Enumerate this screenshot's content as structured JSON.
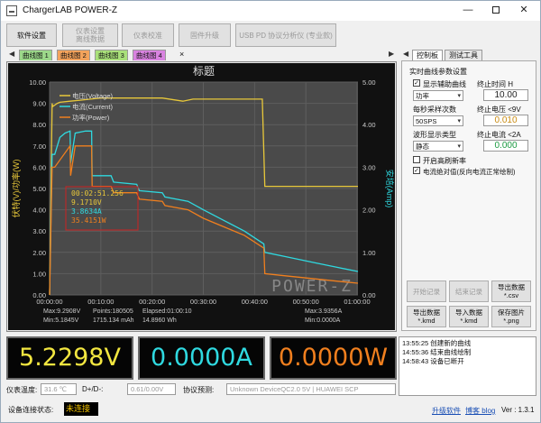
{
  "window": {
    "title": "ChargerLAB POWER-Z",
    "min": "—",
    "max": "☐",
    "close": "✕"
  },
  "toolbar": {
    "settings": "软件设置",
    "dump": "仪表设置\n离线数据",
    "calibrate": "仪表校准",
    "firmware": "固件升级",
    "pd_analyzer": "USB PD 协议分析仪 (专业款)"
  },
  "curve_tabs": [
    {
      "label": "曲线图 1",
      "color": "#9cd88a"
    },
    {
      "label": "曲线图 2",
      "color": "#f3a35c"
    },
    {
      "label": "曲线图 3",
      "color": "#a9e07a"
    },
    {
      "label": "曲线图 4",
      "color": "#d983e0"
    }
  ],
  "tab_close": "×",
  "nav": {
    "left": "◀",
    "right": "▶"
  },
  "chart": {
    "title": "标题",
    "ylabel_left": "伏特(V)/功率(W)",
    "ylabel_right": "安培(Amp)",
    "watermark": "POWER-Z",
    "legend": [
      "电压(Voltage)",
      "电流(Current)",
      "功率(Power)"
    ],
    "readout_box": [
      "00:02:51.256",
      "9.1710V",
      "3.8634A",
      "35.4151W"
    ],
    "footer": {
      "max_v": "Max:9.2908V",
      "min_v": "Min:5.1845V",
      "points": "Points:180505",
      "mah": "1715.134 mAh",
      "elapsed": "Elapsed:01:00:10",
      "wh": "14.8960 Wh",
      "max_a": "Max:3.9356A",
      "min_a": "Min:0.0000A"
    }
  },
  "chart_data": {
    "type": "line",
    "title": "标题",
    "xlabel": "",
    "ylabel": "伏特(V)/功率(W)",
    "ylabel_right": "安培(Amp)",
    "x_ticks": [
      "00:00:00",
      "00:10:00",
      "00:20:00",
      "00:30:00",
      "00:40:00",
      "00:50:00",
      "01:00:00"
    ],
    "y_ticks_left": [
      "0.00",
      "1.00",
      "2.00",
      "3.00",
      "4.00",
      "5.00",
      "6.00",
      "7.00",
      "8.00",
      "9.00",
      "10.00"
    ],
    "y_ticks_right": [
      "0.00",
      "1.00",
      "2.00",
      "3.00",
      "4.00",
      "5.00"
    ],
    "xlim_min": [
      0,
      60.17
    ],
    "ylim_left": [
      0,
      10
    ],
    "ylim_right": [
      0,
      5
    ],
    "grid": true,
    "series": [
      {
        "name": "电压(Voltage)",
        "axis": "left",
        "color": "#e8c83a",
        "x": [
          0,
          0.5,
          0.6,
          1.5,
          2,
          4,
          6,
          8,
          10,
          14,
          18,
          22,
          26,
          28,
          32,
          36,
          40,
          41.5,
          42,
          42.5,
          44,
          48,
          52,
          56,
          60.17
        ],
        "y": [
          0,
          9.0,
          8.85,
          9.0,
          9.05,
          9.1,
          9.15,
          9.2,
          9.25,
          9.25,
          9.25,
          9.25,
          9.1,
          9.2,
          9.2,
          9.2,
          9.2,
          9.2,
          5.1,
          5.1,
          5.1,
          5.1,
          5.1,
          5.1,
          5.1
        ]
      },
      {
        "name": "电流(Current)",
        "axis": "right",
        "color": "#2fd9e0",
        "x": [
          0,
          0.5,
          1,
          2,
          3,
          4,
          4.1,
          5,
          7,
          8.2,
          8.3,
          12,
          12.5,
          17,
          17.5,
          22,
          22.5,
          27,
          30,
          34,
          38,
          41.8,
          42,
          46,
          52,
          56,
          60.17
        ],
        "y": [
          0,
          3.3,
          3.3,
          3.7,
          3.8,
          3.85,
          3.1,
          3.8,
          3.85,
          3.85,
          2.8,
          2.8,
          2.65,
          2.6,
          2.45,
          2.4,
          2.3,
          2.2,
          2.0,
          1.75,
          1.5,
          1.2,
          1.0,
          0.9,
          0.75,
          0.65,
          0.55
        ]
      },
      {
        "name": "功率(Power)",
        "axis": "left",
        "color": "#f07f1e",
        "x": [
          0,
          0.5,
          1,
          4,
          4.1,
          5,
          8.2,
          8.3,
          12,
          12.5,
          17,
          17.5,
          22,
          22.5,
          27,
          30,
          34,
          38,
          41.8,
          42,
          46,
          52,
          56,
          60.17
        ],
        "y": [
          0,
          6.0,
          6.0,
          7.0,
          5.6,
          7.0,
          7.0,
          5.1,
          5.1,
          4.8,
          4.8,
          4.5,
          4.4,
          4.2,
          4.0,
          3.6,
          3.2,
          2.8,
          2.2,
          1.0,
          0.9,
          0.75,
          0.65,
          0.55
        ]
      }
    ]
  },
  "panel": {
    "tabs": [
      "控制板",
      "测试工具"
    ],
    "section": "实时曲线参数设置",
    "show_aux": "显示辅助曲线",
    "aux_value": "功率",
    "end_time_label": "终止时间 H",
    "end_time": "10.00",
    "sample_label": "每秒采样次数",
    "sample_value": "50SPS",
    "end_v_label": "终止电压 <9V",
    "end_v": "0.010",
    "wave_label": "波形显示类型",
    "wave_value": "静态",
    "end_a_label": "终止电流 <2A",
    "end_a": "0.000",
    "hires": "开启高刷新率",
    "absval": "电流绝对值(反向电流正常绘制)",
    "buttons": {
      "start": "开始记录",
      "stop": "结束记录",
      "export_csv": "导出数据\n*.csv",
      "export_kmd": "导出数据\n*.kmd",
      "import_kmd": "导入数据\n*.kmd",
      "save_png": "保存图片\n*.png"
    }
  },
  "readouts": {
    "voltage": "5.2298V",
    "voltage_color": "#f2e640",
    "current": "0.0000A",
    "current_color": "#2fd9e0",
    "power": "0.0000W",
    "power_color": "#f07f1e"
  },
  "status": {
    "temp_label": "仪表温度:",
    "temp": "31.6 ℃",
    "dpdm_label": "D+/D-:",
    "dpdm": "0.61/0.00V",
    "proto_label": "协议预测:",
    "proto": "Unknown DeviceQC2.0 5V | HUAWEI SCP"
  },
  "log": [
    "13:55:25 创建新的曲线",
    "14:55:36 结束曲线绘制",
    "14:58:43 设备已断开"
  ],
  "bottom": {
    "conn_label": "设备连接状态:",
    "conn_value": "未连接",
    "upgrade": "升级软件",
    "blog": "博客 blog",
    "version": "Ver : 1.3.1"
  }
}
